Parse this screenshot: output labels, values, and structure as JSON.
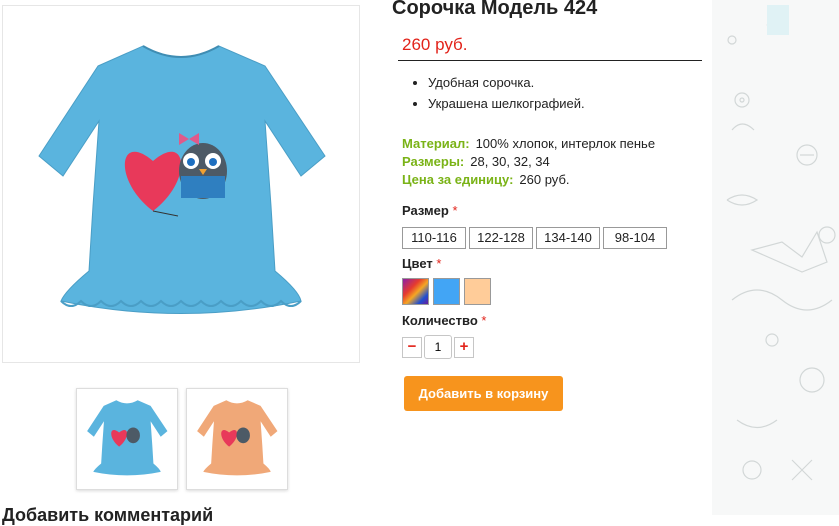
{
  "product": {
    "title": "Сорочка Модель 424",
    "price": "260 руб.",
    "description": [
      "Удобная сорочка.",
      "Украшена шелкографией."
    ],
    "specs": [
      {
        "label": "Материал:",
        "value": "100% хлопок, интерлок пенье"
      },
      {
        "label": "Размеры:",
        "value": "28, 30, 32, 34"
      },
      {
        "label": "Цена за единицу:",
        "value": "260 руб."
      }
    ]
  },
  "options": {
    "size_label": "Размер",
    "sizes": [
      "110-116",
      "122-128",
      "134-140",
      "98-104"
    ],
    "color_label": "Цвет",
    "colors": [
      "multicolor",
      "#42a5f5",
      "#ffcc99"
    ],
    "quantity_label": "Количество",
    "quantity": "1",
    "minus": "−",
    "plus": "+",
    "required_mark": "*"
  },
  "cart_button": "Добавить в корзину",
  "comments_title": "Добавить комментарий",
  "colors": {
    "price": "#e2231a",
    "spec_label": "#7ab317",
    "cart_button": "#f7941d",
    "dress_blue": "#5ab4de",
    "dress_peach": "#f0a878"
  }
}
